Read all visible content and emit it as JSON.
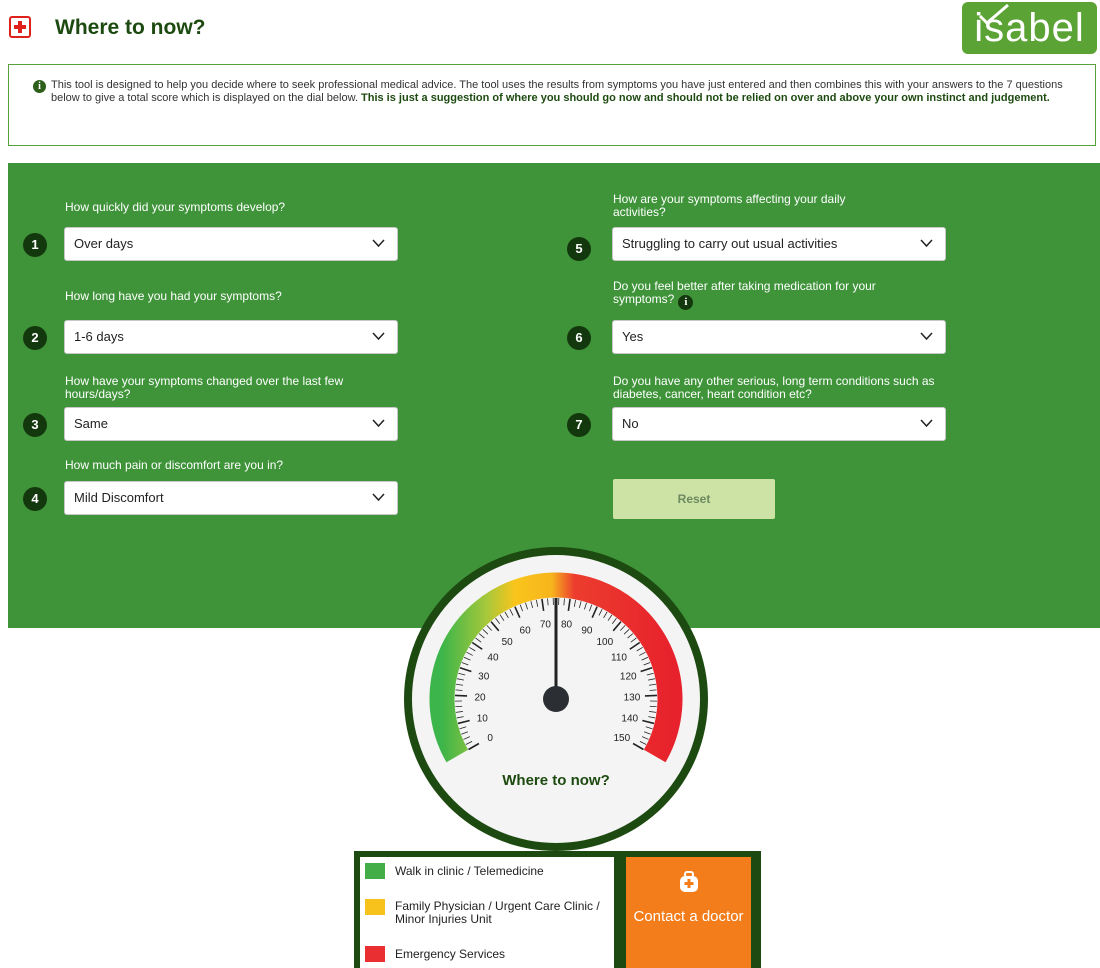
{
  "header": {
    "title": "Where to now?",
    "logo_text": "isabel"
  },
  "info": {
    "text": "This tool is designed to help you decide where to seek professional medical advice. The tool uses the results from symptoms you have just entered and then combines this with your answers to the 7 questions below to give a total score which is displayed on the dial below. ",
    "bold": "This is just a suggestion of where you should go now and should not be relied on over and above your own instinct and judgement."
  },
  "questions": [
    {
      "num": "1",
      "label": "How quickly did your symptoms develop?",
      "value": "Over days"
    },
    {
      "num": "2",
      "label": "How long have you had your symptoms?",
      "value": "1-6 days"
    },
    {
      "num": "3",
      "label": "How have your symptoms changed over the last few hours/days?",
      "value": "Same"
    },
    {
      "num": "4",
      "label": "How much pain or discomfort are you in?",
      "value": "Mild Discomfort"
    },
    {
      "num": "5",
      "label": "How are your symptoms affecting your daily activities?",
      "value": "Struggling to carry out usual activities"
    },
    {
      "num": "6",
      "label": "Do you feel better after taking medication for your symptoms?",
      "value": "Yes"
    },
    {
      "num": "7",
      "label": "Do you have any other serious, long term conditions such as diabetes, cancer, heart condition etc?",
      "value": "No"
    }
  ],
  "reset_label": "Reset",
  "gauge": {
    "label": "Where to now?",
    "min": 0,
    "max": 150,
    "value": 75,
    "ticks": [
      "0",
      "10",
      "20",
      "30",
      "40",
      "50",
      "60",
      "70",
      "80",
      "90",
      "100",
      "110",
      "120",
      "130",
      "140",
      "150"
    ]
  },
  "legend": [
    {
      "label": "Walk in clinic / Telemedicine",
      "color": "#43ad48"
    },
    {
      "label": "Family Physician / Urgent Care Clinic / Minor Injuries Unit",
      "color": "#f7c21b"
    },
    {
      "label": "Emergency Services",
      "color": "#ea2f33"
    }
  ],
  "contact": {
    "label": "Contact a doctor",
    "icon": "doctor-bag-icon"
  },
  "colors": {
    "brand_green": "#3f943a",
    "dark_green": "#1d4a10",
    "orange": "#f47d1b"
  }
}
